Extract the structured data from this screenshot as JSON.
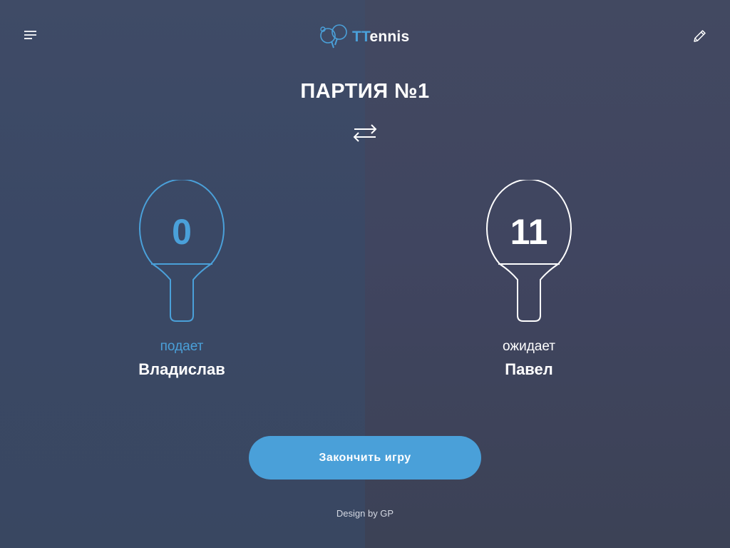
{
  "header": {
    "logo_tt": "TT",
    "logo_rest": "ennis",
    "menu_icon": "hamburger-menu-icon",
    "edit_icon": "pencil-icon",
    "logo_icon": "ping-pong-paddles-icon"
  },
  "game": {
    "title": "ПАРТИЯ №1",
    "swap_icon": "swap-arrows-icon"
  },
  "players": [
    {
      "score": "0",
      "status": "подает",
      "name": "Владислав",
      "active": true
    },
    {
      "score": "11",
      "status": "ожидает",
      "name": "Павел",
      "active": false
    }
  ],
  "actions": {
    "end_game_label": "Закончить игру"
  },
  "footer": {
    "credit": "Design by GP"
  },
  "colors": {
    "accent": "#4aa0d9",
    "text": "#ffffff",
    "bg_left": "#3b4864",
    "bg_right": "#41465f"
  }
}
